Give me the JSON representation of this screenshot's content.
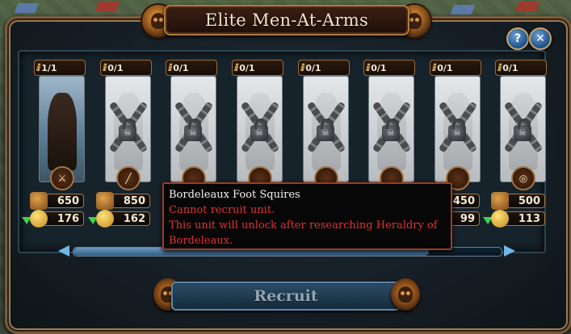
{
  "window": {
    "title": "Elite Men-At-Arms",
    "help_label": "?",
    "close_label": "✕"
  },
  "units": [
    {
      "pop": "1/1",
      "wood": "650",
      "gold": "176",
      "locked": false,
      "type_icon": "axe-icon",
      "type_glyph": "⚔"
    },
    {
      "pop": "0/1",
      "wood": "850",
      "gold": "162",
      "locked": true,
      "type_icon": "sword-icon",
      "type_glyph": "╱"
    },
    {
      "pop": "0/1",
      "wood": "",
      "gold": "",
      "locked": true,
      "type_icon": "unit-type-icon",
      "type_glyph": ""
    },
    {
      "pop": "0/1",
      "wood": "",
      "gold": "",
      "locked": true,
      "type_icon": "unit-type-icon",
      "type_glyph": ""
    },
    {
      "pop": "0/1",
      "wood": "",
      "gold": "",
      "locked": true,
      "type_icon": "unit-type-icon",
      "type_glyph": ""
    },
    {
      "pop": "0/1",
      "wood": "",
      "gold": "",
      "locked": true,
      "type_icon": "unit-type-icon",
      "type_glyph": ""
    },
    {
      "pop": "0/1",
      "wood": "450",
      "gold": "99",
      "locked": true,
      "type_icon": "unit-type-icon",
      "type_glyph": ""
    },
    {
      "pop": "0/1",
      "wood": "500",
      "gold": "113",
      "locked": true,
      "type_icon": "bow-icon",
      "type_glyph": "◎"
    }
  ],
  "tooltip": {
    "title": "Bordeleaux Foot Squires",
    "line1": "Cannot recruit unit.",
    "line2": "This unit will unlock after researching Heraldry of",
    "line3": "Bordeleaux."
  },
  "recruit_label": "Recruit",
  "scroll": {
    "position": 0.0,
    "visible_fraction": 0.83
  },
  "colors": {
    "accent": "#9a7a55",
    "warning": "#e03232",
    "available": "#3fd24a"
  }
}
